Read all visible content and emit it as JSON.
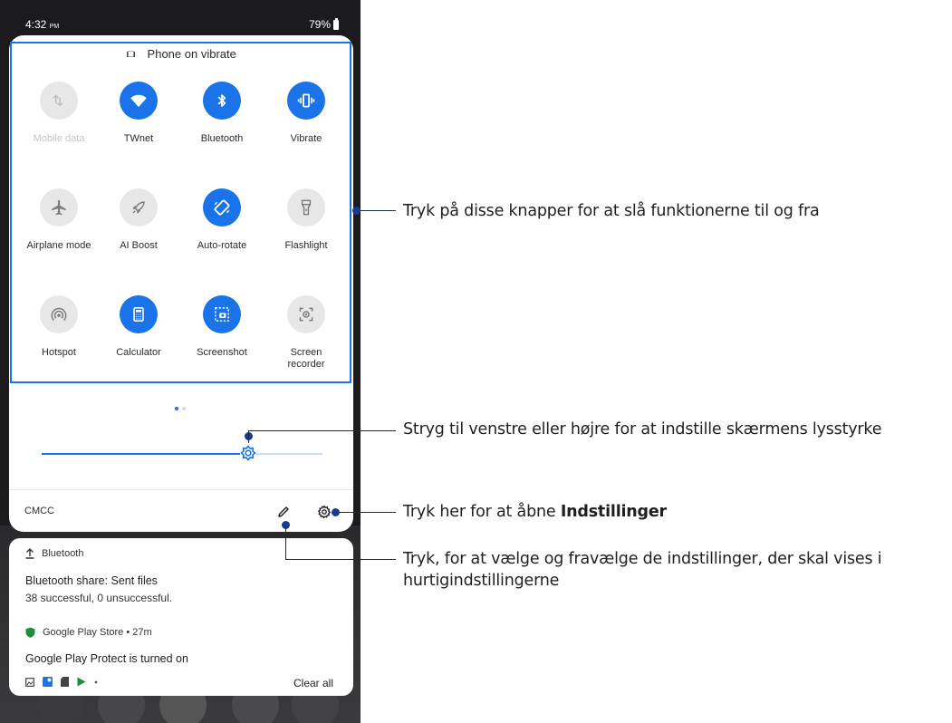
{
  "colors": {
    "accent": "#1a73e8",
    "tile_off": "#e7e7e7",
    "callout_dot": "#1a3a8f",
    "play_protect": "#1e8e3e"
  },
  "status_bar": {
    "time": "4:32",
    "time_suffix": "PM",
    "battery": "79%"
  },
  "header": {
    "vibrate_label": "Phone on vibrate"
  },
  "tiles": [
    {
      "label": "Mobile data",
      "icon": "mobile-data-icon",
      "state": "off",
      "dim": true
    },
    {
      "label": "TWnet",
      "icon": "wifi-icon",
      "state": "on"
    },
    {
      "label": "Bluetooth",
      "icon": "bluetooth-icon",
      "state": "on"
    },
    {
      "label": "Vibrate",
      "icon": "vibrate-icon",
      "state": "on"
    },
    {
      "label": "Airplane mode",
      "icon": "airplane-icon",
      "state": "off"
    },
    {
      "label": "AI Boost",
      "icon": "rocket-icon",
      "state": "off"
    },
    {
      "label": "Auto-rotate",
      "icon": "rotate-icon",
      "state": "on"
    },
    {
      "label": "Flashlight",
      "icon": "flashlight-icon",
      "state": "off"
    },
    {
      "label": "Hotspot",
      "icon": "hotspot-icon",
      "state": "off"
    },
    {
      "label": "Calculator",
      "icon": "calculator-icon",
      "state": "on"
    },
    {
      "label": "Screenshot",
      "icon": "screenshot-icon",
      "state": "on"
    },
    {
      "label": "Screen recorder",
      "icon": "screen-recorder-icon",
      "state": "off"
    }
  ],
  "brightness": {
    "level": 0.735
  },
  "footer": {
    "carrier": "CMCC"
  },
  "notifications": {
    "bluetooth": {
      "app": "Bluetooth",
      "title": "Bluetooth share: Sent files",
      "body": "38 successful, 0 unsuccessful."
    },
    "play_store": {
      "app": "Google Play Store • 27m",
      "title": "Google Play Protect is turned on"
    },
    "clear_all": "Clear all"
  },
  "callouts": {
    "toggle": "Tryk på disse knapper for at slå funktionerne til og fra",
    "brightness": "Stryg til venstre eller højre for at indstille skærmens lysstyrke",
    "settings_prefix": "Tryk her for at åbne ",
    "settings_bold": "Indstillinger",
    "edit_line1": "Tryk, for at vælge og fravælge de indstillinger, der skal vises i",
    "edit_line2": "hurtigindstillingerne"
  }
}
